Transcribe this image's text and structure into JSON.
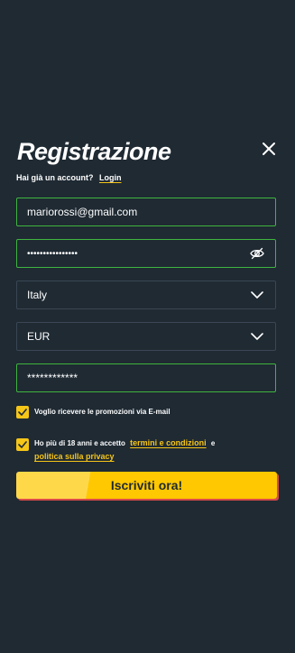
{
  "header": {
    "title": "Registrazione",
    "close_icon": "close-icon"
  },
  "login": {
    "prompt": "Hai già un account?",
    "link": "Login"
  },
  "form": {
    "email": "mariorossi@gmail.com",
    "password": "••••••••••••••••",
    "password_icon": "eye-off-icon",
    "country": "Italy",
    "currency": "EUR",
    "promo_code": "************"
  },
  "consents": {
    "promo_label": "Voglio ricevere le promozioni via E-mail",
    "age_prefix": "Ho più di 18 anni e accetto",
    "terms_link": "termini e condizioni",
    "and": "e",
    "privacy_link": "politica sulla privacy"
  },
  "submit": {
    "label": "Iscriviti ora!"
  },
  "colors": {
    "background": "#1f2a33",
    "accent": "#f5c518",
    "valid_border": "#3fb53f",
    "field_border": "#3a4654",
    "cta_shadow": "#d94a4a"
  }
}
